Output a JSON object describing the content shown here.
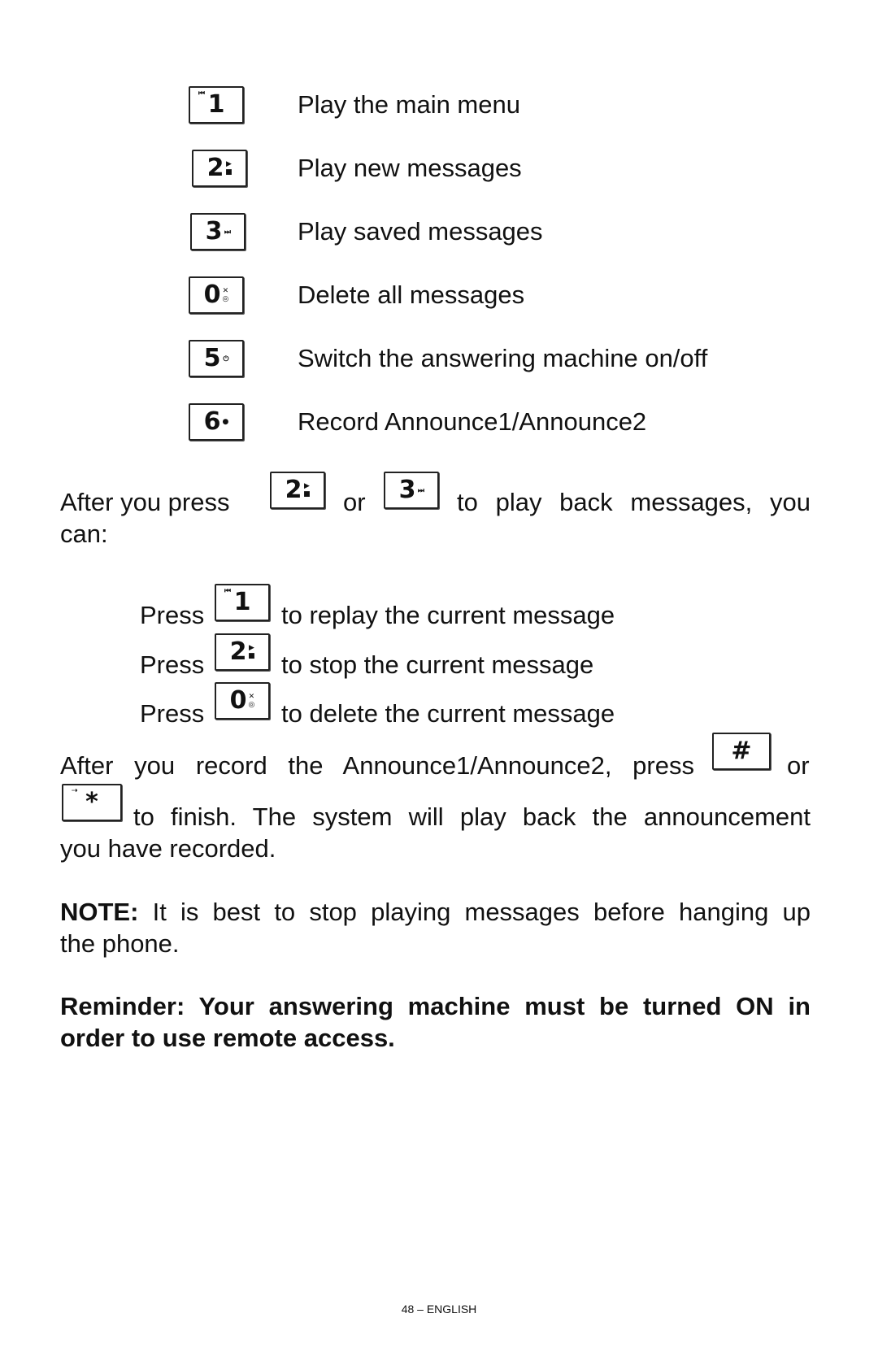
{
  "menu": [
    {
      "key": "1",
      "icon": "prev-key-1-icon",
      "label": "Play the main menu"
    },
    {
      "key": "2",
      "icon": "play-stop-key-2-icon",
      "label": "Play new messages"
    },
    {
      "key": "3",
      "icon": "next-key-3-icon",
      "label": "Play saved messages"
    },
    {
      "key": "0",
      "icon": "delete-key-0-icon",
      "label": "Delete all messages"
    },
    {
      "key": "5",
      "icon": "on-off-key-5-icon",
      "label": "Switch the answering machine on/off"
    },
    {
      "key": "6",
      "icon": "record-key-6-icon",
      "label": "Record Announce1/Announce2"
    }
  ],
  "after_press": {
    "a": "After you press",
    "or": "or",
    "b": "to play back messages, you",
    "c": "can:"
  },
  "press": [
    {
      "label": "Press",
      "key": "1",
      "text": "to replay the current message"
    },
    {
      "label": "Press",
      "key": "2",
      "text": "to stop the current message"
    },
    {
      "label": "Press",
      "key": "0",
      "text": "to delete the current message"
    }
  ],
  "record": {
    "a": "After you record the Announce1/Announce2, press",
    "hash": "#",
    "or": "or",
    "star": "*",
    "b": "to finish.  The system will play back the announcement",
    "c": "you have recorded."
  },
  "note": {
    "bold": "NOTE:",
    "a": "It is best to stop playing messages before hanging up",
    "b": "the phone."
  },
  "reminder": {
    "a": "Reminder:  Your answering machine must be turned ON in",
    "b": "order to use remote access."
  },
  "footer": "48 – ENGLISH"
}
